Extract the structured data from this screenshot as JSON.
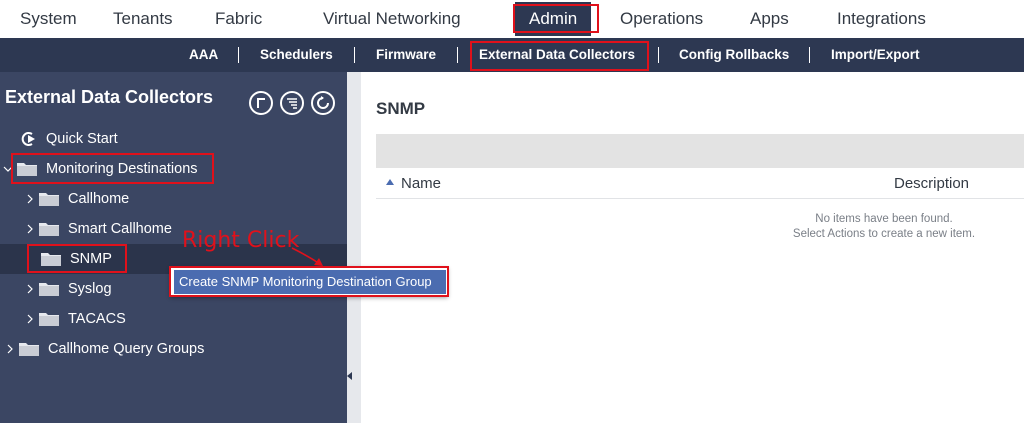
{
  "topnav": {
    "tabs": [
      "System",
      "Tenants",
      "Fabric",
      "Virtual Networking",
      "Admin",
      "Operations",
      "Apps",
      "Integrations"
    ],
    "active": "Admin"
  },
  "subnav": {
    "items": [
      "AAA",
      "Schedulers",
      "Firmware",
      "External Data Collectors",
      "Config Rollbacks",
      "Import/Export"
    ],
    "active": "External Data Collectors"
  },
  "left": {
    "title": "External Data Collectors",
    "toolbar_icons": [
      "flag-icon",
      "filter-list-icon",
      "refresh-icon"
    ],
    "tree": [
      {
        "label": "Quick Start",
        "icon": "quick-start-icon"
      },
      {
        "label": "Monitoring Destinations",
        "icon": "folder-icon",
        "expanded": true
      },
      {
        "label": "Callhome",
        "icon": "folder-icon"
      },
      {
        "label": "Smart Callhome",
        "icon": "folder-icon"
      },
      {
        "label": "SNMP",
        "icon": "folder-icon",
        "selected": true
      },
      {
        "label": "Syslog",
        "icon": "folder-icon"
      },
      {
        "label": "TACACS",
        "icon": "folder-icon"
      },
      {
        "label": "Callhome Query Groups",
        "icon": "folder-icon"
      }
    ]
  },
  "context_menu": {
    "items": [
      "Create SNMP Monitoring Destination Group"
    ]
  },
  "annotation": {
    "text": "Right Click"
  },
  "right": {
    "title": "SNMP",
    "columns": [
      "Name",
      "Description"
    ],
    "empty_line1": "No items have been found.",
    "empty_line2": "Select Actions to create a new item."
  },
  "colors": {
    "nav_dark": "#2d3852",
    "panel": "#3b4663",
    "highlight": "#e0111b",
    "menu_blue": "#4b6cb0"
  }
}
